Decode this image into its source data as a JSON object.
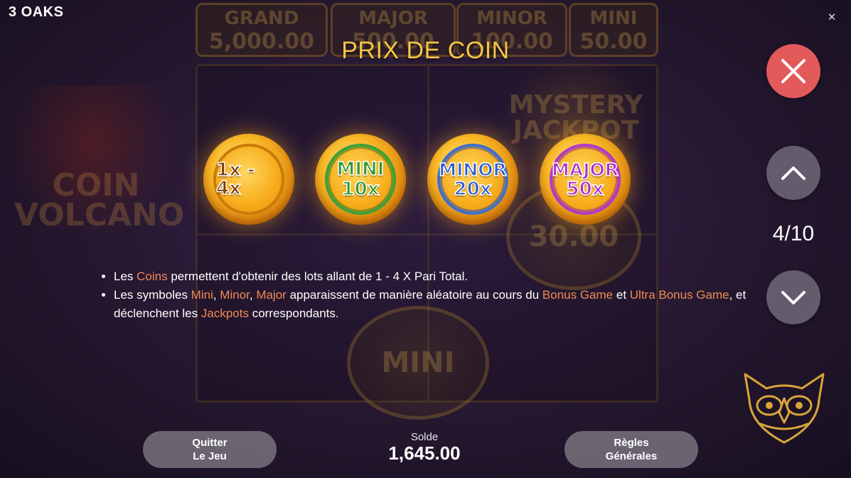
{
  "app": {
    "brand": "3 OAKS",
    "close_glyph": "✕"
  },
  "background": {
    "jackpots": [
      {
        "label": "GRAND",
        "value": "5,000.00"
      },
      {
        "label": "MAJOR",
        "value": "500.00"
      },
      {
        "label": "MINOR",
        "value": "100.00"
      },
      {
        "label": "MINI",
        "value": "50.00"
      }
    ],
    "game_logo": "COIN VOLCANO",
    "mystery_jackpot": "MYSTERY JACKPOT",
    "coin_value": "30.00",
    "mini_coin": "MINI"
  },
  "page": {
    "title": "PRIX DE COIN",
    "current_page": "4",
    "total_pages": "10"
  },
  "coins": [
    {
      "label": "1x - 4x",
      "multiplier": ""
    },
    {
      "label": "MINI",
      "multiplier": "10x"
    },
    {
      "label": "MINOR",
      "multiplier": "20x"
    },
    {
      "label": "MAJOR",
      "multiplier": "50x"
    }
  ],
  "description": {
    "bullet1": {
      "p1": "Les ",
      "h1": "Coins",
      "p2": " permettent d'obtenir des lots allant de 1 - 4 X Pari Total."
    },
    "bullet2": {
      "p1": "Les symboles ",
      "h1": "Mini",
      "p2": ", ",
      "h2": "Minor",
      "p3": ", ",
      "h3": "Major",
      "p4": " apparaissent de manière aléatoire au cours du ",
      "h4": "Bonus Game",
      "p5": " et ",
      "h5": "Ultra Bonus Game",
      "p6": ", et déclenchent les ",
      "h6": "Jackpots",
      "p7": " correspondants."
    }
  },
  "footer": {
    "quit_line1": "Quitter",
    "quit_line2": "Le Jeu",
    "balance_label": "Solde",
    "balance_value": "1,645.00",
    "rules_line1": "Règles",
    "rules_line2": "Générales"
  },
  "colors": {
    "title": "#f6c544",
    "highlight": "#ee8b52",
    "close_button": "#e25a5a",
    "nav_button": "#6e6878",
    "owl_gold": "#d9a53a"
  },
  "icons": {
    "close": "close-icon",
    "up": "chevron-up-icon",
    "down": "chevron-down-icon",
    "logo": "owl-logo-icon"
  }
}
